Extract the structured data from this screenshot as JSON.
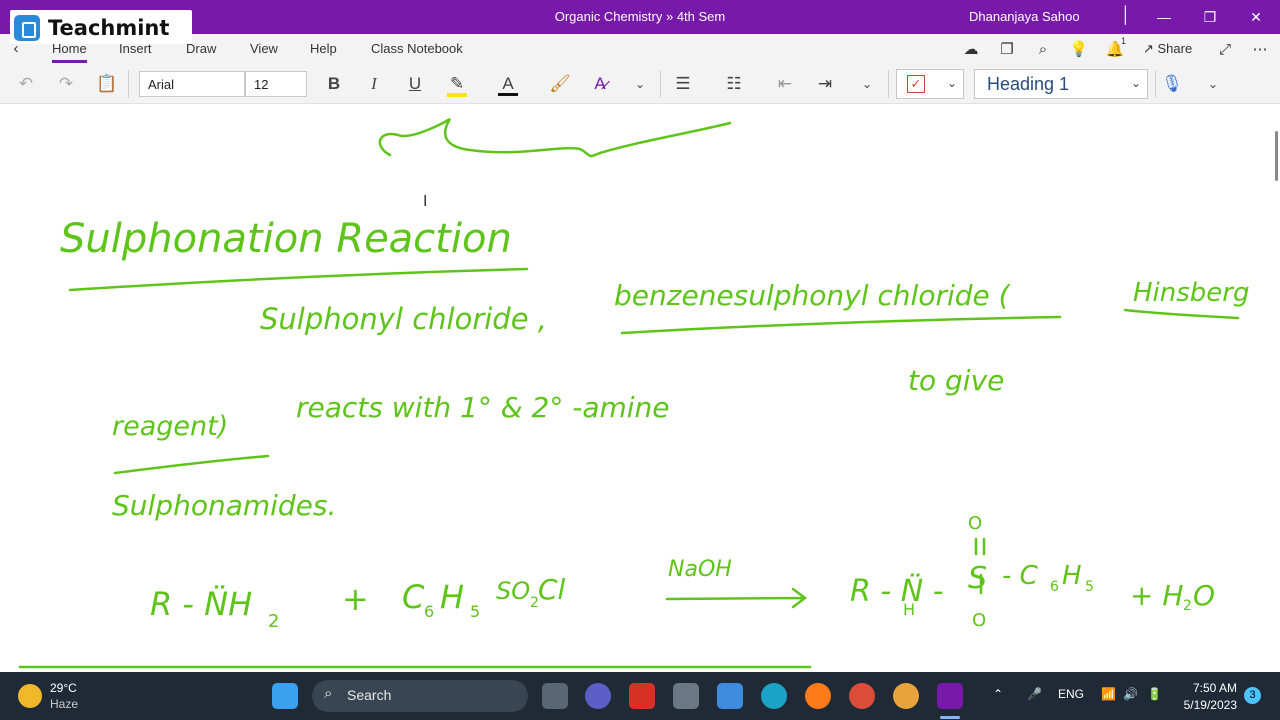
{
  "window": {
    "title": "Organic Chemistry » 4th Sem",
    "user": "Dhananjaya Sahoo",
    "controls": {
      "minimize": "—",
      "restore": "❐",
      "close": "✕"
    }
  },
  "brand": {
    "name": "Teachmint"
  },
  "menubar": {
    "tabs": [
      "Home",
      "Insert",
      "Draw",
      "View",
      "Help",
      "Class Notebook"
    ],
    "share_label": "Share",
    "notification_count": "1"
  },
  "toolbar": {
    "font_name": "Arial",
    "font_size": "12",
    "bold": "B",
    "italic": "I",
    "underline": "U",
    "style": "Heading 1"
  },
  "notes": {
    "title": "Sulphonation Reaction",
    "line1a": "Sulphonyl chloride ,",
    "line1b": "benzenesulphonyl chloride (",
    "line1c": "Hinsberg",
    "line2a": "reagent)",
    "line2b": "reacts with 1° & 2° -amine",
    "line2c": "to give",
    "line3": "Sulphonamides.",
    "eq_reactant1": "R - N̈H",
    "eq_reactant1_sub": "2",
    "eq_plus": "+",
    "eq_reactant2": "C",
    "eq_reactant2_sub1": "6",
    "eq_reactant2_h": "H",
    "eq_reactant2_sub2": "5",
    "eq_reactant2_so": "SO",
    "eq_reactant2_sub3": "2",
    "eq_reactant2_cl": "Cl",
    "eq_condition": "NaOH",
    "eq_product_r": "R - N̈ -",
    "eq_product_h": "H",
    "eq_product_s": "S",
    "eq_product_o_top": "O",
    "eq_product_o_bottom": "O",
    "eq_product_c6h5": "- C",
    "eq_product_c6h5_sub1": "6",
    "eq_product_c6h5_h": "H",
    "eq_product_c6h5_sub2": "5",
    "eq_plus2": "+ H",
    "eq_water_sub": "2",
    "eq_water_o": "O"
  },
  "taskbar": {
    "temperature": "29°C",
    "weather": "Haze",
    "search_label": "Search",
    "language": "ENG",
    "time": "7:50 AM",
    "date": "5/19/2023",
    "notification_count": "3"
  },
  "colors": {
    "accent": "#7719aa",
    "ink": "#5fc41a",
    "taskbar": "#1f2a36"
  }
}
